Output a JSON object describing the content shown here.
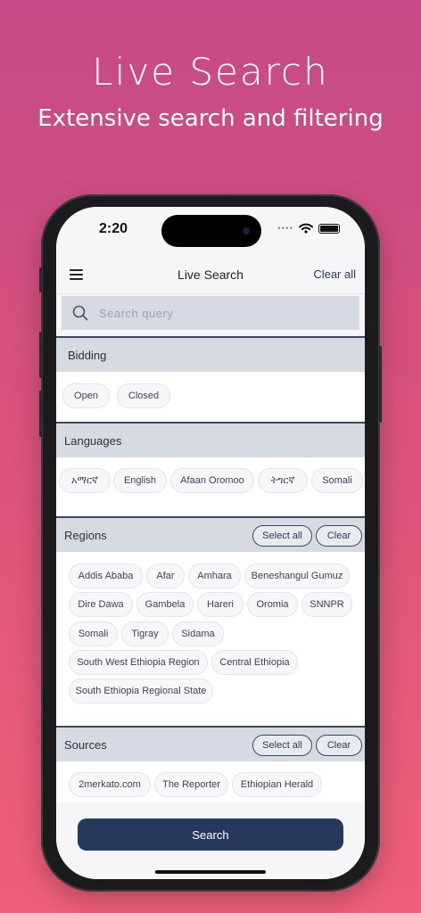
{
  "promo": {
    "title": "Live Search",
    "subtitle": "Extensive search and filtering"
  },
  "status_bar": {
    "time": "2:20",
    "signal": "••••"
  },
  "header": {
    "title": "Live Search",
    "clear_all": "Clear all"
  },
  "search": {
    "placeholder": "Search query"
  },
  "sections": {
    "bidding": {
      "label": "Bidding",
      "options": [
        "Open",
        "Closed"
      ]
    },
    "languages": {
      "label": "Languages",
      "options": [
        "አማርኛ",
        "English",
        "Afaan Oromoo",
        "ትግርኛ",
        "Somali"
      ]
    },
    "regions": {
      "label": "Regions",
      "select_all": "Select all",
      "clear": "Clear",
      "options": [
        "Addis Ababa",
        "Afar",
        "Amhara",
        "Beneshangul Gumuz",
        "Dire Dawa",
        "Gambela",
        "Hareri",
        "Oromia",
        "SNNPR",
        "Somali",
        "Tigray",
        "Sidama",
        "South West Ethiopia  Region",
        "Central Ethiopia",
        "South Ethiopia Regional State"
      ]
    },
    "sources": {
      "label": "Sources",
      "select_all": "Select all",
      "clear": "Clear",
      "options": [
        "2merkato.com",
        "The Reporter",
        "Ethiopian Herald"
      ]
    }
  },
  "footer": {
    "search_button": "Search"
  }
}
